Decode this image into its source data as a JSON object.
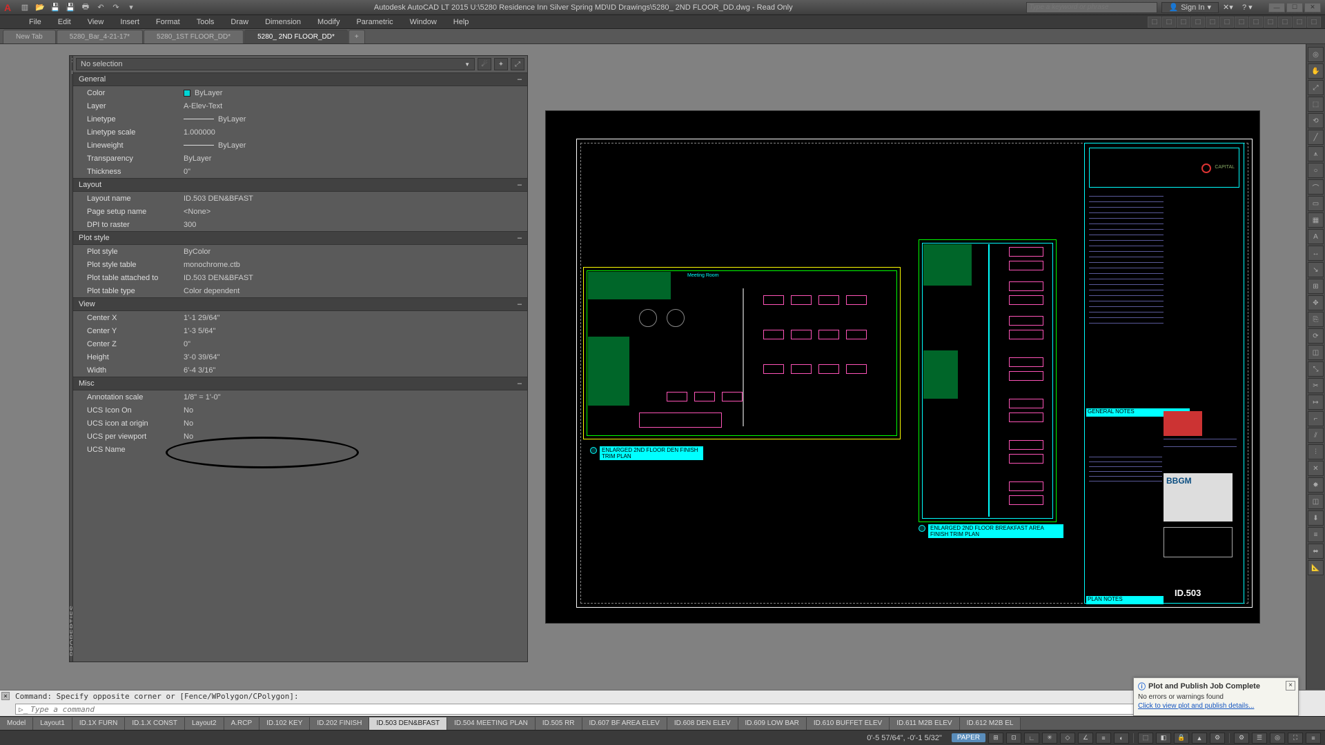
{
  "title": "Autodesk AutoCAD LT 2015   U:\\5280 Residence Inn Silver Spring MD\\ID Drawings\\5280_ 2ND FLOOR_DD.dwg - Read Only",
  "search_placeholder": "Type a keyword or phrase",
  "signin": "Sign In",
  "menus": [
    "File",
    "Edit",
    "View",
    "Insert",
    "Format",
    "Tools",
    "Draw",
    "Dimension",
    "Modify",
    "Parametric",
    "Window",
    "Help"
  ],
  "filetabs": [
    {
      "label": "New Tab",
      "active": false
    },
    {
      "label": "5280_Bar_4-21-17*",
      "active": false
    },
    {
      "label": "5280_1ST FLOOR_DD*",
      "active": false
    },
    {
      "label": "5280_ 2ND FLOOR_DD*",
      "active": true
    }
  ],
  "props": {
    "selection": "No selection",
    "sections": {
      "general": {
        "title": "General",
        "rows": [
          {
            "lbl": "Color",
            "val": "ByLayer",
            "swatch": true
          },
          {
            "lbl": "Layer",
            "val": "A-Elev-Text"
          },
          {
            "lbl": "Linetype",
            "val": "ByLayer",
            "line": true
          },
          {
            "lbl": "Linetype scale",
            "val": "1.000000"
          },
          {
            "lbl": "Lineweight",
            "val": "ByLayer",
            "line": true
          },
          {
            "lbl": "Transparency",
            "val": "ByLayer"
          },
          {
            "lbl": "Thickness",
            "val": "0\""
          }
        ]
      },
      "layout": {
        "title": "Layout",
        "rows": [
          {
            "lbl": "Layout name",
            "val": "ID.503 DEN&BFAST"
          },
          {
            "lbl": "Page setup name",
            "val": "<None>"
          },
          {
            "lbl": "DPI to raster",
            "val": "300"
          }
        ]
      },
      "plotstyle": {
        "title": "Plot style",
        "rows": [
          {
            "lbl": "Plot style",
            "val": "ByColor"
          },
          {
            "lbl": "Plot style table",
            "val": "monochrome.ctb"
          },
          {
            "lbl": "Plot table attached to",
            "val": "ID.503 DEN&BFAST"
          },
          {
            "lbl": "Plot table type",
            "val": "Color dependent"
          }
        ]
      },
      "view": {
        "title": "View",
        "rows": [
          {
            "lbl": "Center X",
            "val": "1'-1 29/64\""
          },
          {
            "lbl": "Center Y",
            "val": "1'-3 5/64\""
          },
          {
            "lbl": "Center Z",
            "val": "0\""
          },
          {
            "lbl": "Height",
            "val": "3'-0 39/64\""
          },
          {
            "lbl": "Width",
            "val": "6'-4 3/16\""
          }
        ]
      },
      "misc": {
        "title": "Misc",
        "rows": [
          {
            "lbl": "Annotation scale",
            "val": "1/8\" = 1'-0\""
          },
          {
            "lbl": "UCS Icon On",
            "val": "No"
          },
          {
            "lbl": "UCS icon at origin",
            "val": "No"
          },
          {
            "lbl": "UCS per viewport",
            "val": "No"
          },
          {
            "lbl": "UCS Name",
            "val": ""
          }
        ]
      }
    }
  },
  "layouttabs": [
    "Model",
    "Layout1",
    "ID.1X FURN",
    "ID.1.X CONST",
    "Layout2",
    "A.RCP",
    "ID.102 KEY",
    "ID.202 FINISH",
    "ID.503 DEN&BFAST",
    "ID.504 MEETING PLAN",
    "ID.505 RR",
    "ID.607 BF AREA ELEV",
    "ID.608 DEN ELEV",
    "ID.609 LOW BAR",
    "ID.610 BUFFET ELEV",
    "ID.611 M2B ELEV",
    "ID.612 M2B EL"
  ],
  "layouttab_active": "ID.503 DEN&BFAST",
  "cmd_hist": "Command: Specify opposite corner or [Fence/WPolygon/CPolygon]:",
  "cmd_placeholder": "Type a command",
  "notif": {
    "title": "Plot and Publish Job Complete",
    "msg": "No errors or warnings found",
    "link": "Click to view plot and publish details..."
  },
  "status": {
    "coords": "0'-5 57/64\", -0'-1 5/32\"",
    "mode": "PAPER"
  },
  "sheet": {
    "general_notes": "GENERAL NOTES",
    "plan_notes": "PLAN NOTES",
    "sheetno": "ID.503",
    "label1": "ENLARGED 2ND FLOOR DEN FINISH TRIM PLAN",
    "label2": "ENLARGED 2ND FLOOR BREAKFAST AREA FINISH TRIM PLAN"
  }
}
